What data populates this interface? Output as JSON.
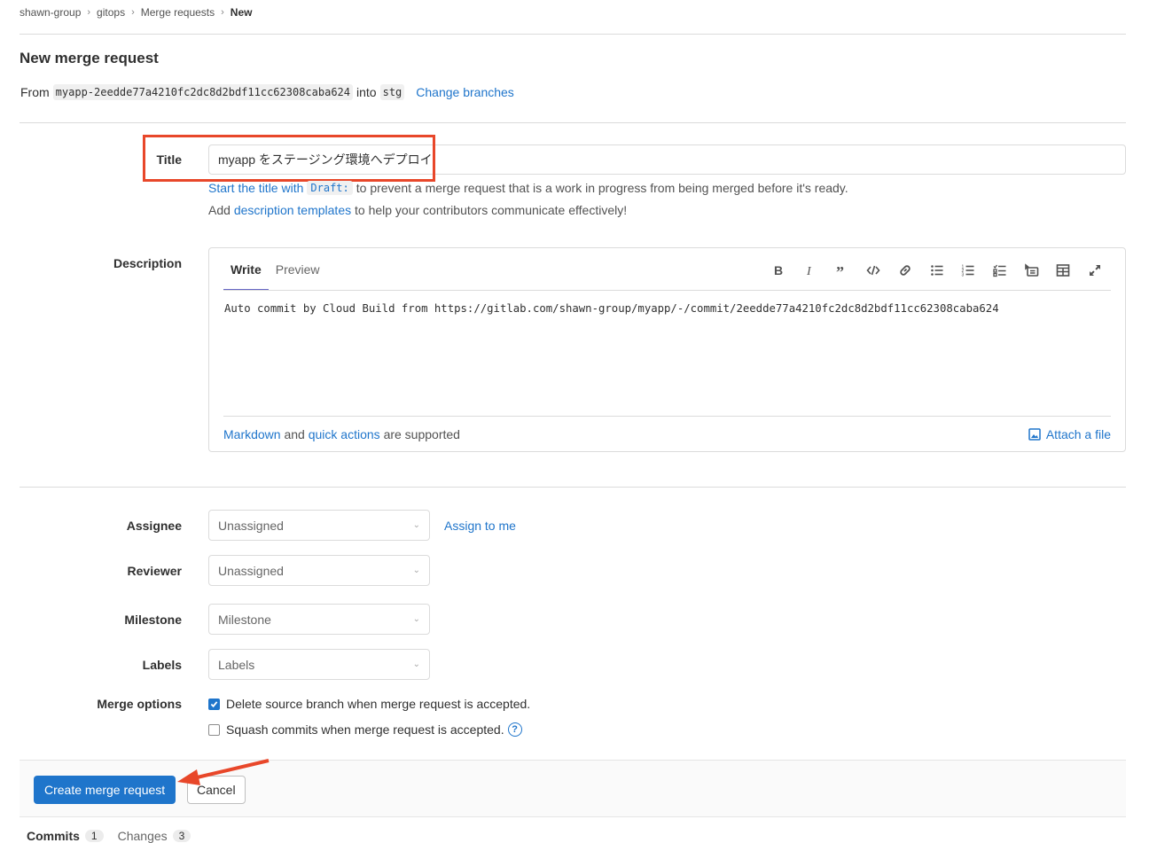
{
  "breadcrumb": [
    "shawn-group",
    "gitops",
    "Merge requests",
    "New"
  ],
  "page_title": "New merge request",
  "branches": {
    "from_label": "From",
    "source": "myapp-2eedde77a4210fc2dc8d2bdf11cc62308caba624",
    "into_label": "into",
    "target": "stg",
    "change_link": "Change branches"
  },
  "title_field": {
    "label": "Title",
    "value": "myapp をステージング環境へデプロイ",
    "help1_link": "Start the title with",
    "help1_code": "Draft:",
    "help1_rest": "to prevent a merge request that is a work in progress from being merged before it's ready.",
    "help2_pre": "Add",
    "help2_link": "description templates",
    "help2_rest": "to help your contributors communicate effectively!"
  },
  "description": {
    "label": "Description",
    "tabs": [
      "Write",
      "Preview"
    ],
    "active_tab": "Write",
    "toolbar": [
      "bold-icon",
      "italic-icon",
      "quote-icon",
      "code-icon",
      "link-icon",
      "bullet-list-icon",
      "numbered-list-icon",
      "task-list-icon",
      "collapsible-icon",
      "table-icon",
      "fullscreen-icon"
    ],
    "text": "Auto commit by Cloud Build from https://gitlab.com/shawn-group/myapp/-/commit/2eedde77a4210fc2dc8d2bdf11cc62308caba624",
    "footer_link1": "Markdown",
    "footer_and": "and",
    "footer_link2": "quick actions",
    "footer_rest": "are supported",
    "attach": "Attach a file"
  },
  "fields": {
    "assignee": {
      "label": "Assignee",
      "value": "Unassigned",
      "assign_me": "Assign to me"
    },
    "reviewer": {
      "label": "Reviewer",
      "value": "Unassigned"
    },
    "milestone": {
      "label": "Milestone",
      "value": "Milestone"
    },
    "labels": {
      "label": "Labels",
      "value": "Labels"
    }
  },
  "merge_options": {
    "label": "Merge options",
    "delete_branch": {
      "label": "Delete source branch when merge request is accepted.",
      "checked": true
    },
    "squash": {
      "label": "Squash commits when merge request is accepted.",
      "checked": false
    }
  },
  "actions": {
    "create": "Create merge request",
    "cancel": "Cancel"
  },
  "bottom_tabs": [
    {
      "label": "Commits",
      "count": "1"
    },
    {
      "label": "Changes",
      "count": "3"
    }
  ],
  "colors": {
    "accent": "#1f75cb",
    "annotation": "#e8472a"
  }
}
